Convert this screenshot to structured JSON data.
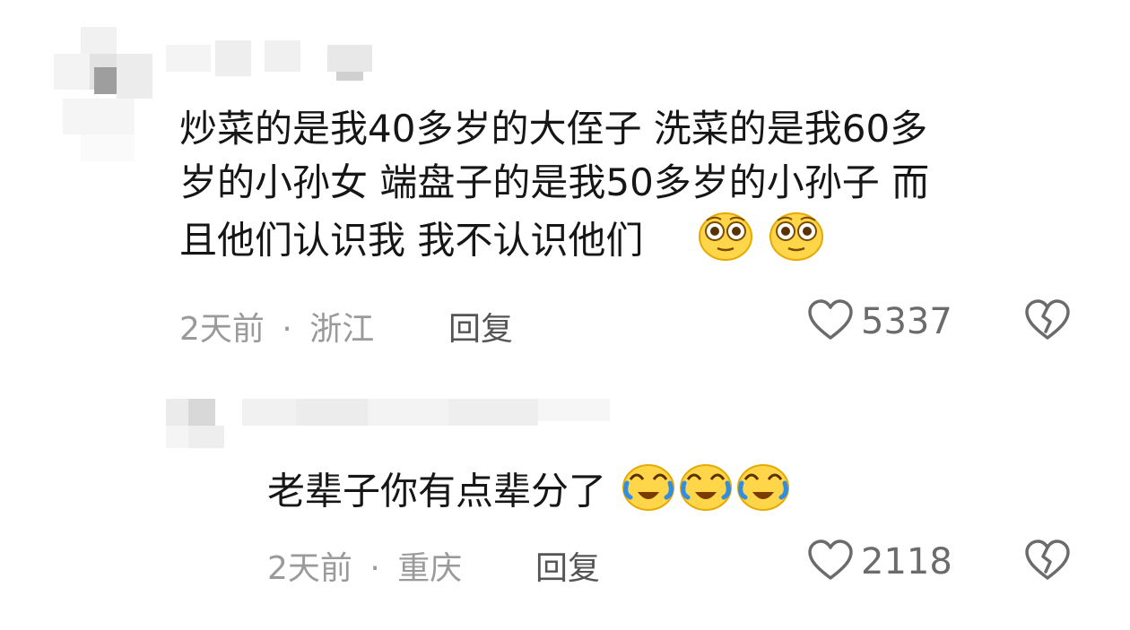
{
  "comments": [
    {
      "lines": [
        "炒菜的是我40多岁的大侄子  洗菜的是我60多",
        "岁的小孙女 端盘子的是我50多岁的小孙子  而",
        "且他们认识我 我不认识他们"
      ],
      "emoji": [
        "rolling-eyes-emoji",
        "rolling-eyes-emoji"
      ],
      "time": "2天前",
      "location": "浙江",
      "sep": "·",
      "reply": "回复",
      "likes": "5337"
    },
    {
      "lines": [
        "老辈子你有点辈分了"
      ],
      "emoji": [
        "crying-laughing-emoji",
        "crying-laughing-emoji",
        "crying-laughing-emoji"
      ],
      "time": "2天前",
      "location": "重庆",
      "sep": "·",
      "reply": "回复",
      "likes": "2118"
    }
  ],
  "colors": {
    "text": "#161616",
    "meta": "#9a9a9a",
    "icon": "#6b6b6b"
  }
}
